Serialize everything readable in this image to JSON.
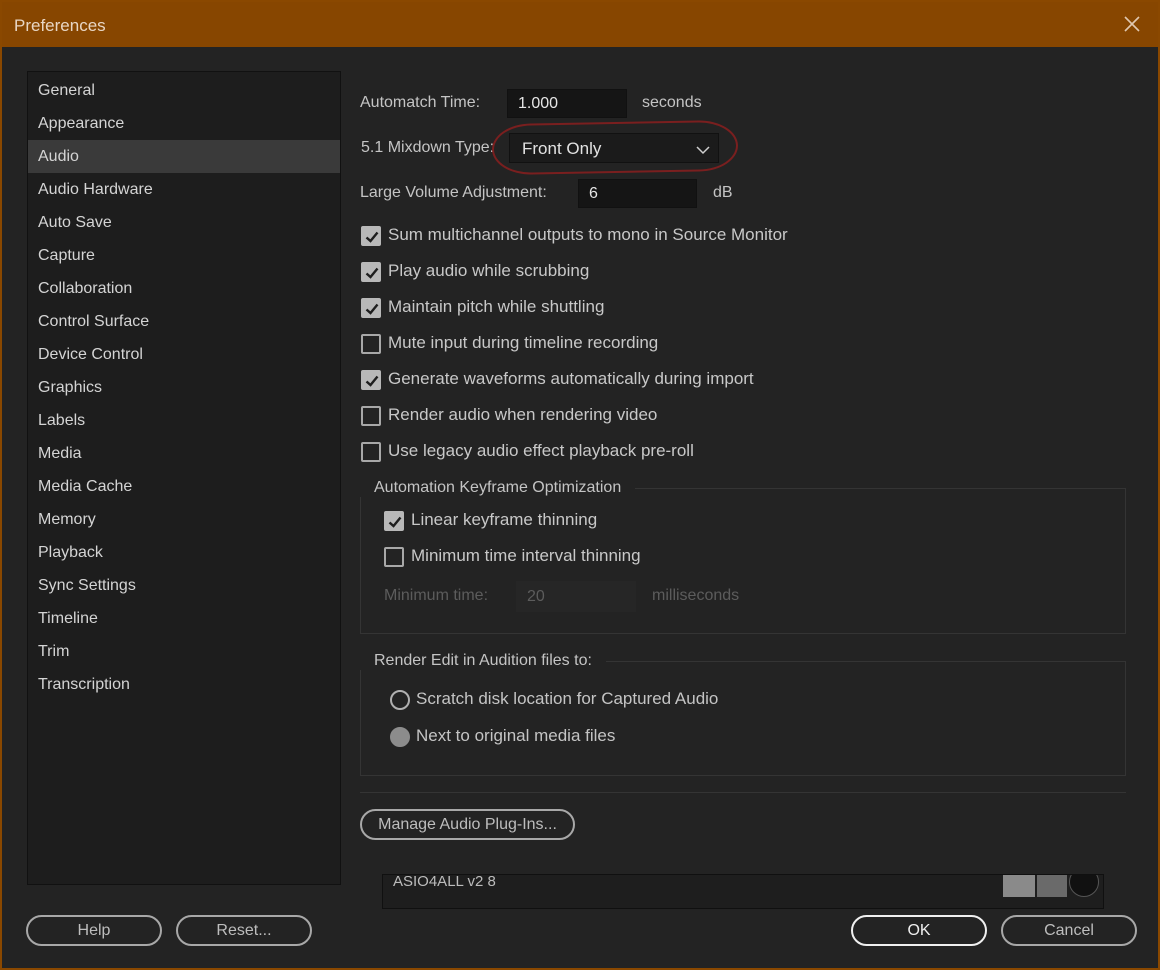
{
  "window": {
    "title": "Preferences"
  },
  "sidebar": {
    "items": [
      {
        "label": "General"
      },
      {
        "label": "Appearance"
      },
      {
        "label": "Audio"
      },
      {
        "label": "Audio Hardware"
      },
      {
        "label": "Auto Save"
      },
      {
        "label": "Capture"
      },
      {
        "label": "Collaboration"
      },
      {
        "label": "Control Surface"
      },
      {
        "label": "Device Control"
      },
      {
        "label": "Graphics"
      },
      {
        "label": "Labels"
      },
      {
        "label": "Media"
      },
      {
        "label": "Media Cache"
      },
      {
        "label": "Memory"
      },
      {
        "label": "Playback"
      },
      {
        "label": "Sync Settings"
      },
      {
        "label": "Timeline"
      },
      {
        "label": "Trim"
      },
      {
        "label": "Transcription"
      }
    ],
    "selected": "Audio"
  },
  "audio": {
    "automatch_label": "Automatch Time:",
    "automatch_value": "1.000",
    "automatch_unit": "seconds",
    "mixdown_label": "5.1 Mixdown Type:",
    "mixdown_value": "Front Only",
    "volume_label": "Large Volume Adjustment:",
    "volume_value": "6",
    "volume_unit": "dB",
    "options": [
      {
        "label": "Sum multichannel outputs to mono in Source Monitor",
        "checked": true
      },
      {
        "label": "Play audio while scrubbing",
        "checked": true
      },
      {
        "label": "Maintain pitch while shuttling",
        "checked": true
      },
      {
        "label": "Mute input during timeline recording",
        "checked": false
      },
      {
        "label": "Generate waveforms automatically during import",
        "checked": true
      },
      {
        "label": "Render audio when rendering video",
        "checked": false
      },
      {
        "label": "Use legacy audio effect playback pre-roll",
        "checked": false
      }
    ],
    "keyframe_group": {
      "title": "Automation Keyframe Optimization",
      "options": [
        {
          "label": "Linear keyframe thinning",
          "checked": true
        },
        {
          "label": "Minimum time interval thinning",
          "checked": false
        }
      ],
      "min_time_label": "Minimum time:",
      "min_time_value": "20",
      "min_time_unit": "milliseconds"
    },
    "render_group": {
      "title": "Render Edit in Audition files to:",
      "options": [
        {
          "label": "Scratch disk location for Captured Audio",
          "selected": false
        },
        {
          "label": "Next to original media files",
          "selected": true
        }
      ]
    },
    "plugins_button": "Manage Audio Plug-Ins...",
    "device_name": "ASIO4ALL v2 8"
  },
  "footer": {
    "help": "Help",
    "reset": "Reset...",
    "ok": "OK",
    "cancel": "Cancel"
  },
  "colors": {
    "titlebar": "#874600",
    "background": "#232323",
    "sidebar_selected": "#3a3a3a",
    "highlight_ring": "#7a1f1f"
  },
  "icons": {
    "close": "close-icon",
    "dropdown": "chevron-down-icon",
    "check": "checkmark-icon"
  }
}
